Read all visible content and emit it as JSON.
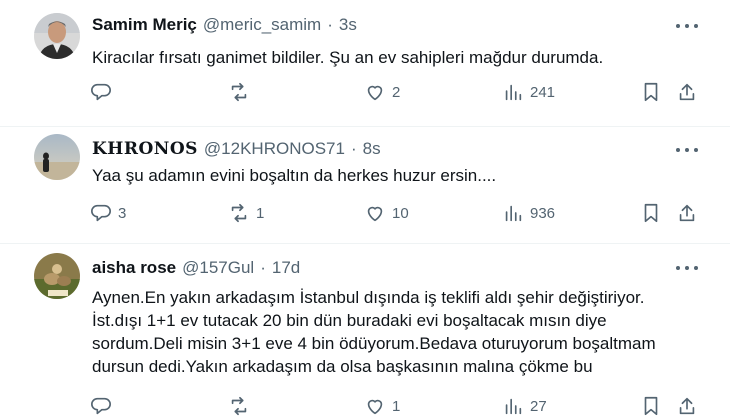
{
  "tweets": [
    {
      "name": "Samim Meriç",
      "handle": "@meric_samim",
      "sep": "·",
      "time": "3s",
      "text": "Kiracılar fırsatı ganimet bildiler. Şu an ev sahipleri mağdur durumda.",
      "replies": "",
      "retweets": "",
      "likes": "2",
      "views": "241"
    },
    {
      "name": "KHRONOS",
      "handle": "@12KHRONOS71",
      "sep": "·",
      "time": "8s",
      "text": "Yaa şu adamın evini boşaltın da herkes huzur ersin....",
      "replies": "3",
      "retweets": "1",
      "likes": "10",
      "views": "936"
    },
    {
      "name": "aisha rose",
      "handle": "@157Gul",
      "sep": "·",
      "time": "17d",
      "text": "Aynen.En yakın arkadaşım İstanbul dışında iş teklifi aldı şehir değiştiriyor. İst.dışı 1+1 ev tutacak 20 bin dün buradaki evi boşaltacak mısın diye sordum.Deli misin 3+1 eve 4 bin ödüyorum.Bedava oturuyorum boşaltmam dursun dedi.Yakın arkadaşım da olsa başkasının malına çökme bu",
      "replies": "",
      "retweets": "",
      "likes": "1",
      "views": "27"
    }
  ],
  "icons": [
    "reply-icon",
    "retweet-icon",
    "like-icon",
    "views-icon",
    "bookmark-icon",
    "share-icon",
    "more-icon"
  ],
  "colors": {
    "text": "#0f1419",
    "muted": "#536471",
    "divider": "#eff3f4"
  }
}
